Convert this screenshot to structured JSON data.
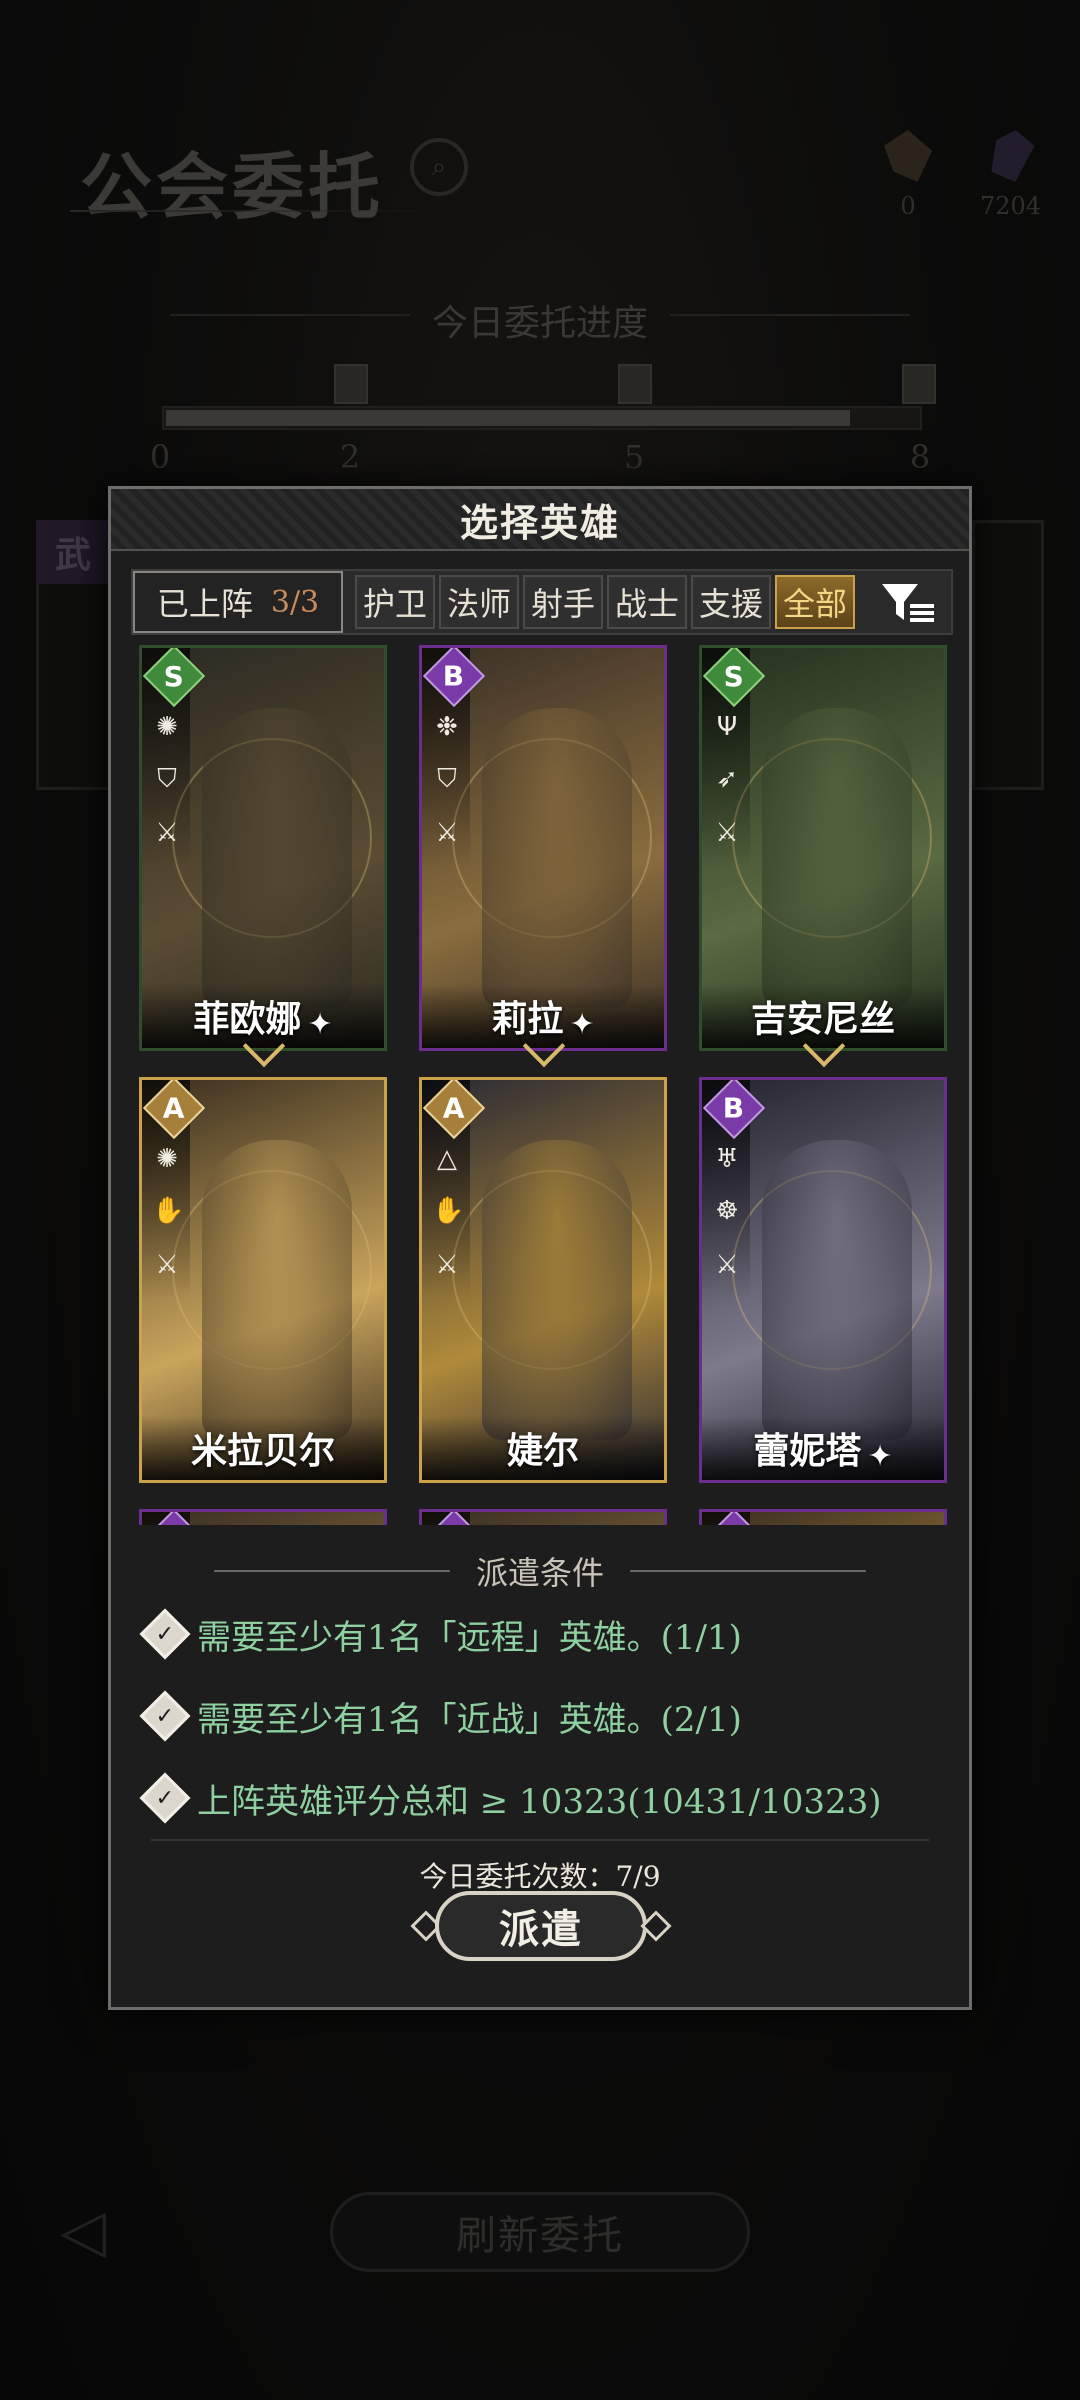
{
  "background": {
    "title": "公会委托",
    "currency": [
      {
        "icon": "gold-shard-icon",
        "value": "0"
      },
      {
        "icon": "purple-crystal-icon",
        "value": "7204"
      }
    ],
    "progress": {
      "title": "今日委托进度",
      "ticks": [
        "0",
        "2",
        "5",
        "8"
      ],
      "fill": 0.91
    },
    "left_tag": "武",
    "refresh_label": "刷新委托"
  },
  "modal": {
    "title": "选择英雄",
    "deployed_label": "已上阵",
    "deployed_count": "3/3",
    "class_tabs": [
      {
        "label": "护卫",
        "active": false
      },
      {
        "label": "法师",
        "active": false
      },
      {
        "label": "射手",
        "active": false
      },
      {
        "label": "战士",
        "active": false
      },
      {
        "label": "支援",
        "active": false
      },
      {
        "label": "全部",
        "active": true
      }
    ],
    "heroes": [
      {
        "name": "菲欧娜",
        "rarity": "S",
        "star": "✦",
        "selected": true,
        "traits": [
          "sun-icon",
          "shield-icon",
          "melee-icon"
        ],
        "colors": [
          "#2b2a22",
          "#5b4c33"
        ]
      },
      {
        "name": "莉拉",
        "rarity": "B",
        "star": "✦",
        "selected": true,
        "traits": [
          "snowflake-icon",
          "shield-icon",
          "melee-icon"
        ],
        "colors": [
          "#3a3027",
          "#8a6d3d"
        ]
      },
      {
        "name": "吉安尼丝",
        "rarity": "S",
        "star": "",
        "selected": true,
        "traits": [
          "tree-icon",
          "bow-icon",
          "melee-icon"
        ],
        "colors": [
          "#25301f",
          "#5a6a42"
        ]
      },
      {
        "name": "米拉贝尔",
        "rarity": "A",
        "star": "",
        "selected": false,
        "traits": [
          "sun-icon",
          "hand-icon",
          "melee-icon"
        ],
        "colors": [
          "#3a2f1f",
          "#c9a45c"
        ]
      },
      {
        "name": "婕尔",
        "rarity": "A",
        "star": "",
        "selected": false,
        "traits": [
          "triangle-icon",
          "hand-icon",
          "melee-icon"
        ],
        "colors": [
          "#2b2a33",
          "#b08a3a"
        ]
      },
      {
        "name": "蕾妮塔",
        "rarity": "B",
        "star": "✦",
        "selected": false,
        "traits": [
          "demon-icon",
          "swirl-icon",
          "melee-icon"
        ],
        "colors": [
          "#26232f",
          "#7d7a8c"
        ]
      },
      {
        "name": "",
        "rarity": "B",
        "star": "",
        "selected": false,
        "traits": [],
        "colors": [
          "#3a2e22",
          "#a88a4a"
        ]
      },
      {
        "name": "",
        "rarity": "B",
        "star": "",
        "selected": false,
        "traits": [],
        "colors": [
          "#3a2e22",
          "#a88a4a"
        ]
      },
      {
        "name": "",
        "rarity": "B",
        "star": "",
        "selected": false,
        "traits": [],
        "colors": [
          "#3a2e22",
          "#c9a040"
        ]
      }
    ],
    "conditions_title": "派遣条件",
    "conditions": [
      "需要至少有1名「远程」英雄。(1/1)",
      "需要至少有1名「近战」英雄。(2/1)",
      "上阵英雄评分总和 ≥ 10323(10431/10323)"
    ],
    "today_count": "今日委托次数：7/9",
    "dispatch_label": "派遣"
  },
  "icons": {
    "check": "✓",
    "sun-icon": "✺",
    "snowflake-icon": "❉",
    "tree-icon": "Ψ",
    "shield-icon": "⛉",
    "bow-icon": "➶",
    "hand-icon": "✋",
    "triangle-icon": "△",
    "demon-icon": "♅",
    "swirl-icon": "☸",
    "melee-icon": "⚔"
  }
}
